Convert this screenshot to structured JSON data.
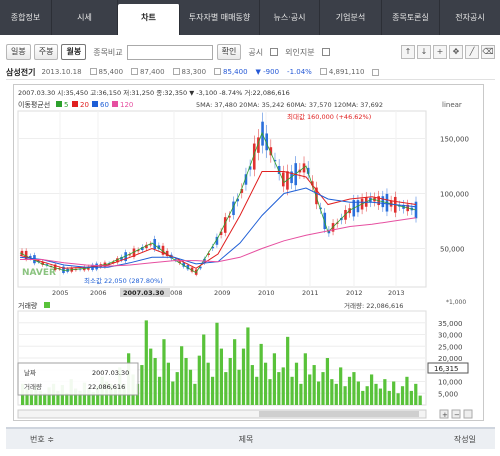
{
  "nav": {
    "tabs": [
      "종합정보",
      "시세",
      "차트",
      "투자자별 매매동향",
      "뉴스·공시",
      "기업분석",
      "종목토론실",
      "전자공시"
    ],
    "active_index": 2
  },
  "toolbar": {
    "day": "일봉",
    "week": "주봉",
    "month": "월봉",
    "compare_label": "종목비교",
    "compare_placeholder": "",
    "confirm": "확인",
    "disclosure": "공시",
    "foreign": "외인지분"
  },
  "stock": {
    "name": "삼성전기",
    "date": "2013.10.18",
    "open": "85,400",
    "high": "87,400",
    "low": "83,300",
    "close": "85,400",
    "change": "▼ -900",
    "change_pct": "-1.04%",
    "volume": "4,891,110"
  },
  "chart_header": {
    "bar": "2007.03.30 시:35,450 고:36,150 저:31,250 종:32,350 ▼ -3,100 -8.74% 거:22,086,616",
    "ma_title": "이동평균선",
    "ma5": "5",
    "ma20": "20",
    "ma60": "60",
    "ma120": "120",
    "ma_vals": "5MA: 37,480  20MA: 35,242  60MA: 37,570  120MA: 37,692",
    "scale": "linear",
    "max_label": "최대값 160,000 (+46.62%)",
    "min_label": "최소값 22,050 (287.80%)",
    "cursor_date": "2007.03.30"
  },
  "volume_header": {
    "title": "거래량",
    "max_vol": "22,086,616",
    "unit": "*1,000",
    "current": "16,315"
  },
  "tooltip": {
    "date_label": "날짜",
    "date": "2007.03.30",
    "vol_label": "거래량",
    "vol": "22,086,616"
  },
  "footer": {
    "col1": "번호 ≑",
    "col2": "제목",
    "col3": "작성일"
  },
  "colors": {
    "ma5": "#2ca02c",
    "ma20": "#e02020",
    "ma60": "#1f5fd6",
    "ma120": "#e64fa0",
    "up": "#e03030",
    "down": "#2a6fdb",
    "vol": "#59c23a"
  },
  "chart_data": [
    {
      "type": "line",
      "x_ticks": [
        "2005",
        "2006",
        "2007.03.30",
        "2008",
        "2009",
        "2010",
        "2011",
        "2012",
        "2013"
      ],
      "y_ticks": [
        50000,
        100000,
        150000
      ],
      "ylim": [
        15000,
        175000
      ],
      "series": [
        {
          "name": "5",
          "values": [
            46000,
            36000,
            30000,
            32000,
            36000,
            45000,
            55000,
            40000,
            28000,
            60000,
            100000,
            155000,
            110000,
            125000,
            65000,
            85000,
            95000,
            90000,
            85000
          ]
        },
        {
          "name": "20",
          "values": [
            44000,
            38000,
            32000,
            33000,
            35000,
            42000,
            50000,
            42000,
            32000,
            45000,
            80000,
            120000,
            120000,
            115000,
            90000,
            95000,
            97000,
            93000,
            90000
          ]
        },
        {
          "name": "60",
          "values": [
            42000,
            40000,
            35000,
            33000,
            33000,
            37000,
            42000,
            42000,
            36000,
            38000,
            55000,
            80000,
            100000,
            105000,
            95000,
            92000,
            92000,
            90000,
            88000
          ]
        },
        {
          "name": "120",
          "values": [
            40000,
            40000,
            37000,
            35000,
            34000,
            35000,
            37000,
            39000,
            39000,
            38000,
            42000,
            50000,
            57000,
            62000,
            66000,
            70000,
            72000,
            75000,
            78000
          ]
        }
      ]
    },
    {
      "type": "bar",
      "title": "거래량",
      "y_ticks": [
        5000,
        10000,
        15000,
        20000,
        25000,
        30000,
        35000
      ],
      "ylim": [
        0,
        40000
      ],
      "values": [
        9000,
        7000,
        6500,
        8000,
        6000,
        5000,
        7500,
        9000,
        6000,
        8500,
        5000,
        11000,
        7000,
        6000,
        9500,
        7000,
        5500,
        8000,
        12000,
        10000,
        9000,
        7500,
        16000,
        9000,
        22000,
        13000,
        9000,
        17000,
        36000,
        24000,
        20000,
        12000,
        28000,
        18000,
        10000,
        14000,
        25000,
        20000,
        15000,
        9000,
        21000,
        30000,
        18000,
        12000,
        35000,
        24000,
        14000,
        20000,
        28000,
        15000,
        24000,
        33000,
        17000,
        12000,
        26000,
        18000,
        11000,
        22000,
        14000,
        16000,
        29000,
        12000,
        18000,
        9000,
        22000,
        13000,
        17000,
        10000,
        14000,
        20000,
        11000,
        9000,
        16000,
        8000,
        12000,
        14000,
        10000,
        6000,
        8000,
        13000,
        9000,
        7000,
        11000,
        6000,
        10000,
        5000,
        8000,
        12000,
        6000,
        9000,
        4000
      ]
    }
  ]
}
